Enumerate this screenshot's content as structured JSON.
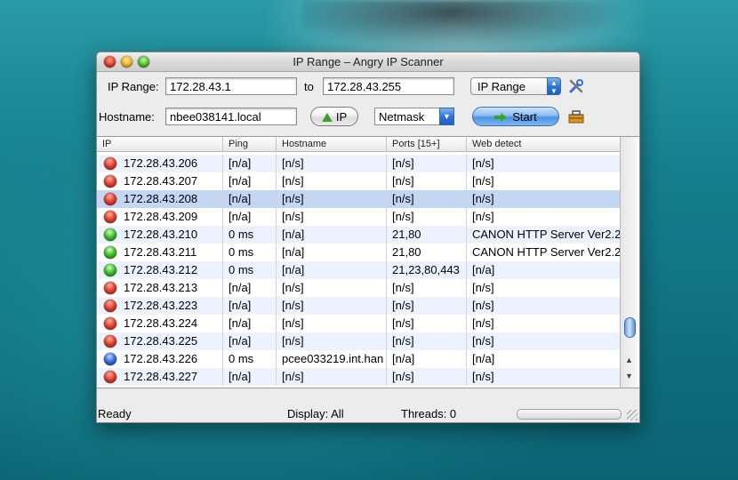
{
  "window": {
    "title": "IP Range – Angry IP Scanner"
  },
  "toolbar": {
    "ip_range_label": "IP Range:",
    "ip_from": "172.28.43.1",
    "to_label": "to",
    "ip_to": "172.28.43.255",
    "feeder_select": "IP Range",
    "hostname_label": "Hostname:",
    "hostname_value": "nbee038141.local",
    "ip_button": "IP",
    "netmask_select": "Netmask",
    "start_button": "Start",
    "prefs_icon": "tools-icon",
    "fetchers_icon": "toolbox-icon"
  },
  "table": {
    "columns": [
      "IP",
      "Ping",
      "Hostname",
      "Ports [15+]",
      "Web detect"
    ],
    "rows": [
      {
        "status": "red",
        "ip": "172.28.43.206",
        "ping": "[n/a]",
        "hostname": "[n/s]",
        "ports": "[n/s]",
        "web": "[n/s]"
      },
      {
        "status": "red",
        "ip": "172.28.43.207",
        "ping": "[n/a]",
        "hostname": "[n/s]",
        "ports": "[n/s]",
        "web": "[n/s]"
      },
      {
        "status": "red",
        "ip": "172.28.43.208",
        "ping": "[n/a]",
        "hostname": "[n/s]",
        "ports": "[n/s]",
        "web": "[n/s]",
        "selected": true
      },
      {
        "status": "red",
        "ip": "172.28.43.209",
        "ping": "[n/a]",
        "hostname": "[n/s]",
        "ports": "[n/s]",
        "web": "[n/s]"
      },
      {
        "status": "green",
        "ip": "172.28.43.210",
        "ping": "0 ms",
        "hostname": "[n/a]",
        "ports": "21,80",
        "web": "CANON HTTP Server Ver2.2"
      },
      {
        "status": "green",
        "ip": "172.28.43.211",
        "ping": "0 ms",
        "hostname": "[n/a]",
        "ports": "21,80",
        "web": "CANON HTTP Server Ver2.2"
      },
      {
        "status": "green",
        "ip": "172.28.43.212",
        "ping": "0 ms",
        "hostname": "[n/a]",
        "ports": "21,23,80,443",
        "web": "[n/a]"
      },
      {
        "status": "red",
        "ip": "172.28.43.213",
        "ping": "[n/a]",
        "hostname": "[n/s]",
        "ports": "[n/s]",
        "web": "[n/s]"
      },
      {
        "status": "red",
        "ip": "172.28.43.223",
        "ping": "[n/a]",
        "hostname": "[n/s]",
        "ports": "[n/s]",
        "web": "[n/s]"
      },
      {
        "status": "red",
        "ip": "172.28.43.224",
        "ping": "[n/a]",
        "hostname": "[n/s]",
        "ports": "[n/s]",
        "web": "[n/s]"
      },
      {
        "status": "red",
        "ip": "172.28.43.225",
        "ping": "[n/a]",
        "hostname": "[n/s]",
        "ports": "[n/s]",
        "web": "[n/s]"
      },
      {
        "status": "blue",
        "ip": "172.28.43.226",
        "ping": "0 ms",
        "hostname": "pcee033219.int.han",
        "ports": "[n/a]",
        "web": "[n/a]"
      },
      {
        "status": "red",
        "ip": "172.28.43.227",
        "ping": "[n/a]",
        "hostname": "[n/s]",
        "ports": "[n/s]",
        "web": "[n/s]"
      }
    ]
  },
  "statusbar": {
    "state": "Ready",
    "display": "Display: All",
    "threads": "Threads: 0"
  },
  "colors": {
    "status_red": "#e2412f",
    "status_green": "#3fbf2a",
    "status_blue": "#3a6ee0",
    "selection": "#c3d6f3",
    "row_alt": "#edf3fe"
  }
}
